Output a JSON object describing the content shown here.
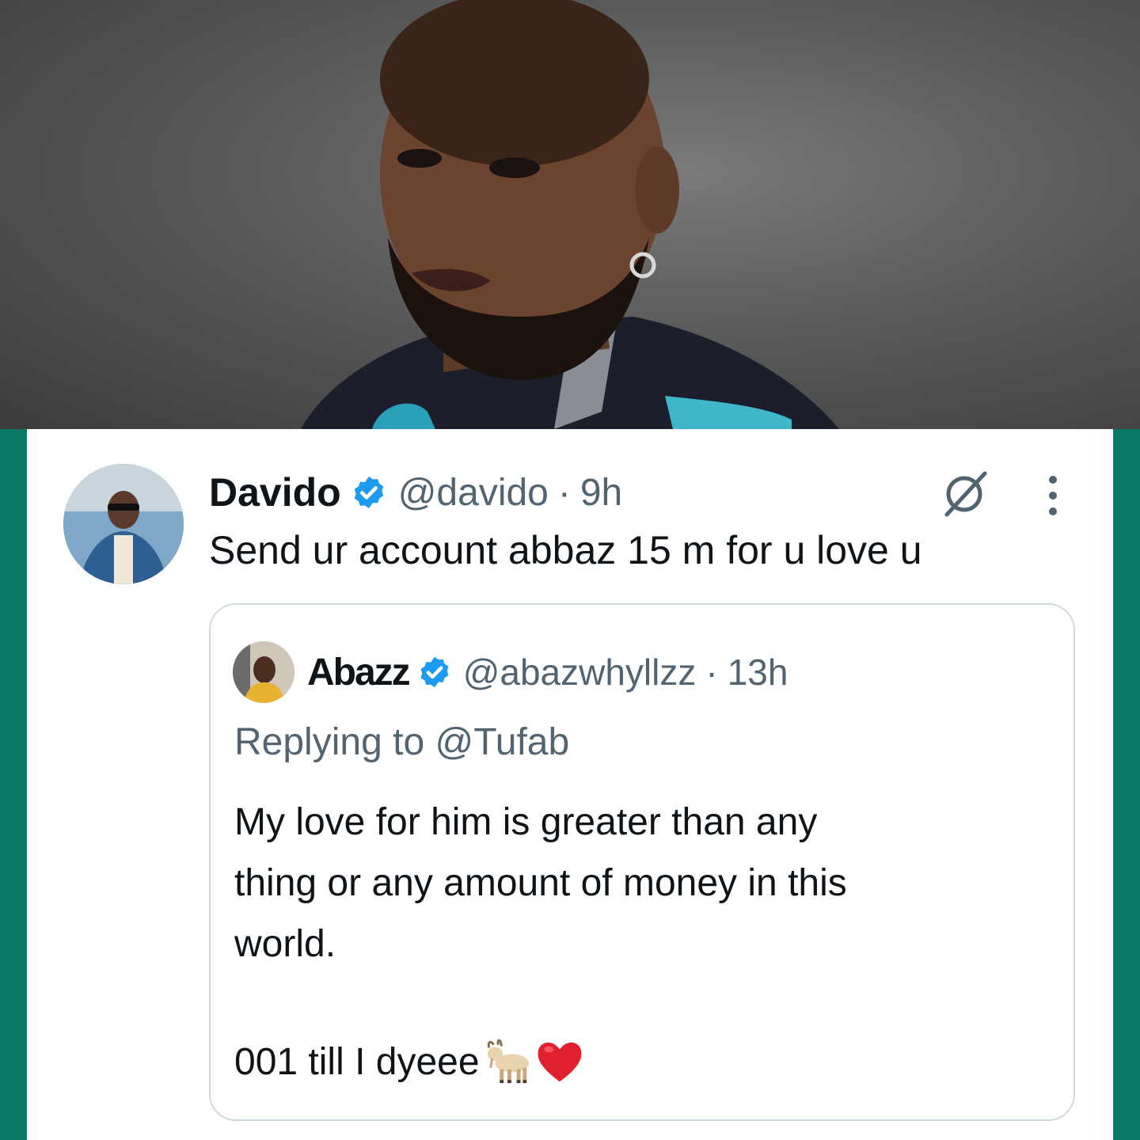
{
  "photo": {
    "alt": "portrait"
  },
  "tweet": {
    "name": "Davido",
    "handle": "@davido",
    "separator": "·",
    "time": "9h",
    "text": "Send ur account abbaz 15 m for u love u"
  },
  "quoted": {
    "name": "Abazz",
    "handle": "@abazwhyllzz",
    "separator": "·",
    "time": "13h",
    "reply_prefix": "Replying to",
    "reply_to": "@Tufab",
    "body": "My love for him is greater than any\nthing or any amount of money in this\nworld.",
    "signoff": "001 till I dyeee",
    "emojis": [
      "goat-emoji",
      "red-heart-emoji"
    ]
  },
  "colors": {
    "frame": "#0a7a66",
    "verified": "#1d9bf0",
    "secondary_text": "#536471",
    "primary_text": "#0f1419",
    "heart": "#e0202e"
  }
}
